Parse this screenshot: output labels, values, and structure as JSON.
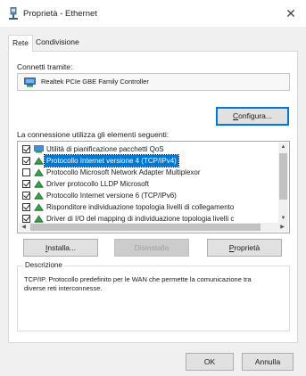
{
  "window": {
    "title": "Proprietà - Ethernet",
    "close_glyph": "✕"
  },
  "tabs": [
    {
      "label": "Rete",
      "active": true
    },
    {
      "label": "Condivisione",
      "active": false
    }
  ],
  "connect_using": {
    "label": "Connetti tramite:",
    "adapter": "Realtek PCIe GBE Family Controller",
    "adapter_icon": "network-adapter-icon"
  },
  "configure_button": "Configura...",
  "items_label": "La connessione utilizza gli elementi seguenti:",
  "items": [
    {
      "label": "Utilità di pianificazione pacchetti QoS",
      "checked": true,
      "icon": "qos-icon",
      "selected": false
    },
    {
      "label": "Protocollo Internet versione 4 (TCP/IPv4)",
      "checked": true,
      "icon": "protocol-icon",
      "selected": true
    },
    {
      "label": "Protocollo Microsoft Network Adapter Multiplexor",
      "checked": false,
      "icon": "protocol-icon",
      "selected": false
    },
    {
      "label": "Driver protocollo LLDP Microsoft",
      "checked": true,
      "icon": "protocol-icon",
      "selected": false
    },
    {
      "label": "Protocollo Internet versione 6 (TCP/IPv6)",
      "checked": true,
      "icon": "protocol-icon",
      "selected": false
    },
    {
      "label": "Risponditore individuazione topologia livelli di collegamento",
      "checked": true,
      "icon": "protocol-icon",
      "selected": false
    },
    {
      "label": "Driver di I/O del mapping di individuazione topologia livelli c",
      "checked": true,
      "icon": "protocol-icon",
      "selected": false
    }
  ],
  "buttons": {
    "install": "Installa...",
    "uninstall": "Disinstalla",
    "properties": "Proprietà"
  },
  "description": {
    "legend": "Descrizione",
    "text": "TCP/IP. Protocollo predefinito per le WAN che permette la comunicazione tra diverse reti interconnesse."
  },
  "dialog_buttons": {
    "ok": "OK",
    "cancel": "Annulla"
  },
  "colors": {
    "selection": "#0078d7",
    "dialog_bg": "#f0f0f0"
  }
}
